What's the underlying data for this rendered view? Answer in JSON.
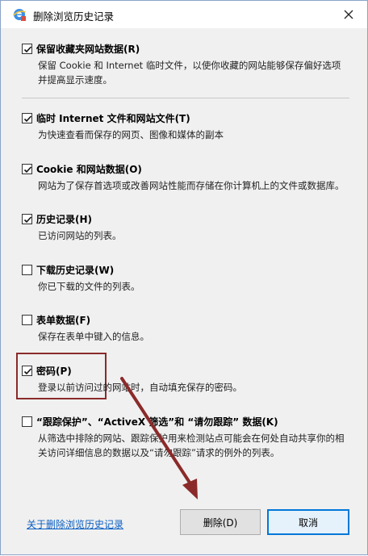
{
  "dialog": {
    "title": "删除浏览历史记录",
    "close_label": "✕"
  },
  "options": [
    {
      "label": "保留收藏夹网站数据(R)",
      "description": "保留 Cookie 和 Internet 临时文件，以使你收藏的网站能够保存偏好选项并提高显示速度。",
      "checked": true
    },
    {
      "label": "临时 Internet 文件和网站文件(T)",
      "description": "为快速查看而保存的网页、图像和媒体的副本",
      "checked": true
    },
    {
      "label": "Cookie 和网站数据(O)",
      "description": "网站为了保存首选项或改善网站性能而存储在你计算机上的文件或数据库。",
      "checked": true
    },
    {
      "label": "历史记录(H)",
      "description": "已访问网站的列表。",
      "checked": true
    },
    {
      "label": "下载历史记录(W)",
      "description": "你已下载的文件的列表。",
      "checked": false
    },
    {
      "label": "表单数据(F)",
      "description": "保存在表单中键入的信息。",
      "checked": false
    },
    {
      "label": "密码(P)",
      "description": "登录以前访问过的网站时，自动填充保存的密码。",
      "checked": true
    },
    {
      "label": "“跟踪保护”、“ActiveX 筛选”和 “请勿跟踪” 数据(K)",
      "description": "从筛选中排除的网站、跟踪保护用来检测站点可能会在何处自动共享你的相关访问详细信息的数据以及“请勿跟踪”请求的例外的列表。",
      "checked": false
    }
  ],
  "footer": {
    "link_text": "关于删除浏览历史记录",
    "delete_label": "删除(D)",
    "cancel_label": "取消"
  },
  "colors": {
    "highlight": "#8b2a2a",
    "link": "#0b5fc2",
    "focus_border": "#0078d7"
  }
}
